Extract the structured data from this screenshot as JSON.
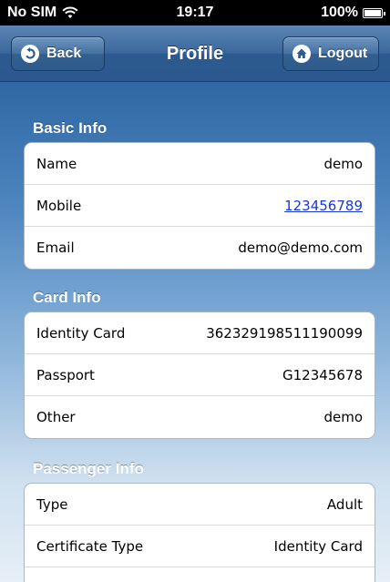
{
  "status_bar": {
    "carrier": "No SIM",
    "time": "19:17",
    "battery": "100%",
    "wifi_icon": "wifi-icon",
    "battery_icon": "battery-icon"
  },
  "nav": {
    "title": "Profile",
    "back_label": "Back",
    "logout_label": "Logout",
    "back_icon": "back-arrow-icon",
    "logout_icon": "home-icon"
  },
  "sections": {
    "basic": {
      "title": "Basic Info",
      "rows": [
        {
          "label": "Name",
          "value": "demo"
        },
        {
          "label": "Mobile",
          "value": "123456789"
        },
        {
          "label": "Email",
          "value": "demo@demo.com"
        }
      ]
    },
    "card": {
      "title": "Card Info",
      "rows": [
        {
          "label": "Identity Card",
          "value": "362329198511190099"
        },
        {
          "label": "Passport",
          "value": "G12345678"
        },
        {
          "label": "Other",
          "value": "demo"
        }
      ]
    },
    "passenger": {
      "title": "Passenger Info",
      "rows": [
        {
          "label": "Type",
          "value": "Adult"
        },
        {
          "label": "Certificate Type",
          "value": "Identity Card"
        }
      ]
    }
  },
  "colors": {
    "nav_bar": "#3a679c",
    "link": "#1a37d6",
    "background_top": "#2f67a4",
    "background_bottom": "#e6eff7"
  }
}
